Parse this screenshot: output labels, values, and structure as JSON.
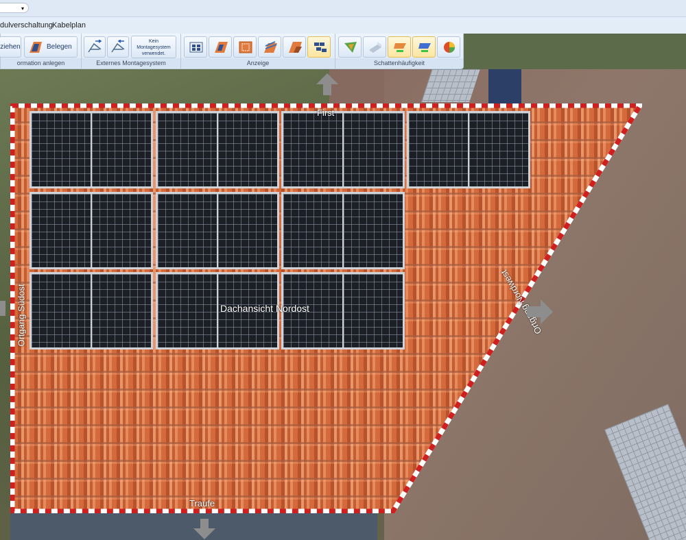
{
  "qat": {
    "dropdown_glyph": "▾"
  },
  "menu": {
    "items": [
      "dulverschaltung",
      "Kabelplan"
    ]
  },
  "ribbon": {
    "groups": [
      {
        "label": "ormation anlegen",
        "buttons": [
          "ziehen",
          "Belegen"
        ]
      },
      {
        "label": "Externes Montagesystem",
        "note": "Kein Montagesystem verwendet."
      },
      {
        "label": "Anzeige"
      },
      {
        "label": "Schattenhäufigkeit"
      }
    ]
  },
  "scene": {
    "first": "First",
    "traufe": "Traufe",
    "view_label": "Dachansicht Nordost",
    "ortgang_left": "Ortgang Südost",
    "ortgang_right": "Ortgang Nordwest"
  },
  "colors": {
    "accent": "#dfe9f5",
    "active_button": "#fde5a0",
    "tile": "#d46a3b",
    "border_stripe": "#d01f1f"
  }
}
